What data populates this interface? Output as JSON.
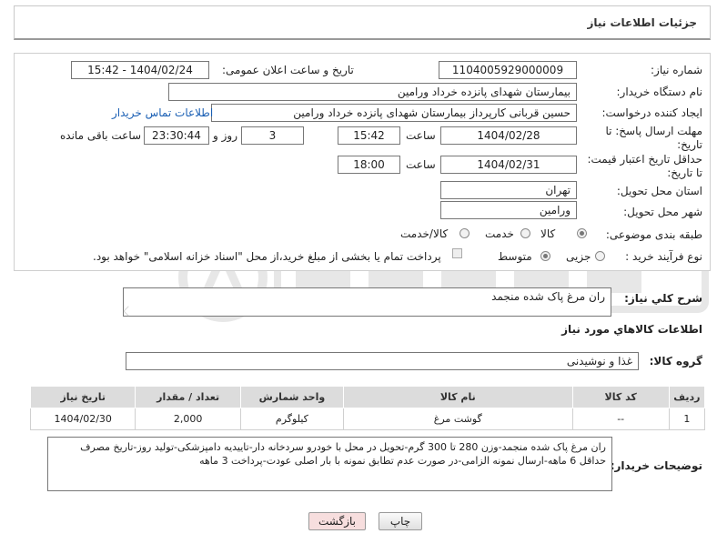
{
  "page": {
    "title": "جزئیات اطلاعات نیاز"
  },
  "form": {
    "need_number_label": "شماره نیاز:",
    "need_number": "1104005929000009",
    "announce_label": "تاریخ و ساعت اعلان عمومی:",
    "announce_value": "1404/02/24 - 15:42",
    "buyer_org_label": "نام دستگاه خریدار:",
    "buyer_org": "بیمارستان شهدای پانزده خرداد ورامین",
    "requester_label": "ایجاد کننده درخواست:",
    "requester": "حسین قربانی کارپرداز بیمارستان شهدای پانزده خرداد ورامین",
    "contact_link": "اطلاعات تماس خریدار",
    "deadline_label_1": "مهلت ارسال پاسخ: تا",
    "deadline_label_2": "تاریخ:",
    "deadline_date": "1404/02/28",
    "time_label": "ساعت",
    "deadline_time": "15:42",
    "days_value": "3",
    "days_label": "روز و",
    "remaining_value": "23:30:44",
    "remaining_label": "ساعت باقی مانده",
    "price_label_1": "حداقل تاریخ اعتبار قیمت:",
    "price_label_2": "تا تاریخ:",
    "price_date": "1404/02/31",
    "price_time": "18:00",
    "province_label": "استان محل تحویل:",
    "province": "تهران",
    "city_label": "شهر محل تحویل:",
    "city": "ورامین",
    "category_label": "طبقه بندی موضوعی:",
    "category_options": [
      "کالا",
      "خدمت",
      "کالا/خدمت"
    ],
    "process_label": "نوع فرآیند خرید :",
    "process_options": [
      "جزیی",
      "متوسط"
    ],
    "payment_note": "پرداخت تمام یا بخشی از مبلغ خرید،از محل \"اسناد خزانه اسلامی\" خواهد بود."
  },
  "summary": {
    "label": "شرح کلي نياز:",
    "value": "ران مرغ پاک شده منجمد"
  },
  "goods": {
    "section_title": "اطلاعات کالاهاي مورد نياز",
    "group_label": "گروه کالا:",
    "group_value": "غذا و نوشیدنی",
    "columns": [
      "ردیف",
      "کد کالا",
      "نام کالا",
      "واحد شمارش",
      "تعداد / مقدار",
      "تاریخ نیاز"
    ],
    "rows": [
      [
        "1",
        "--",
        "گوشت مرغ",
        "کیلوگرم",
        "2,000",
        "1404/02/30"
      ]
    ]
  },
  "notes": {
    "label": "توضیحات خریدار:",
    "line1": "ران مرغ پاک شده منجمد-وزن 280 تا 300 گرم-تحویل در محل با خودرو سردخانه دار-تاییدیه دامپزشکی-تولید روز-تاریخ مصرف",
    "line2": "حداقل 6 ماهه-ارسال نمونه الزامی-در صورت عدم تطابق نمونه با بار اصلی عودت-پرداخت 3 ماهه"
  },
  "buttons": {
    "print": "چاپ",
    "back": "بازگشت"
  },
  "colors": {
    "link": "#1a5fb4",
    "header_bg": "#dcdcdc",
    "back_button_bg": "#f7dede"
  }
}
